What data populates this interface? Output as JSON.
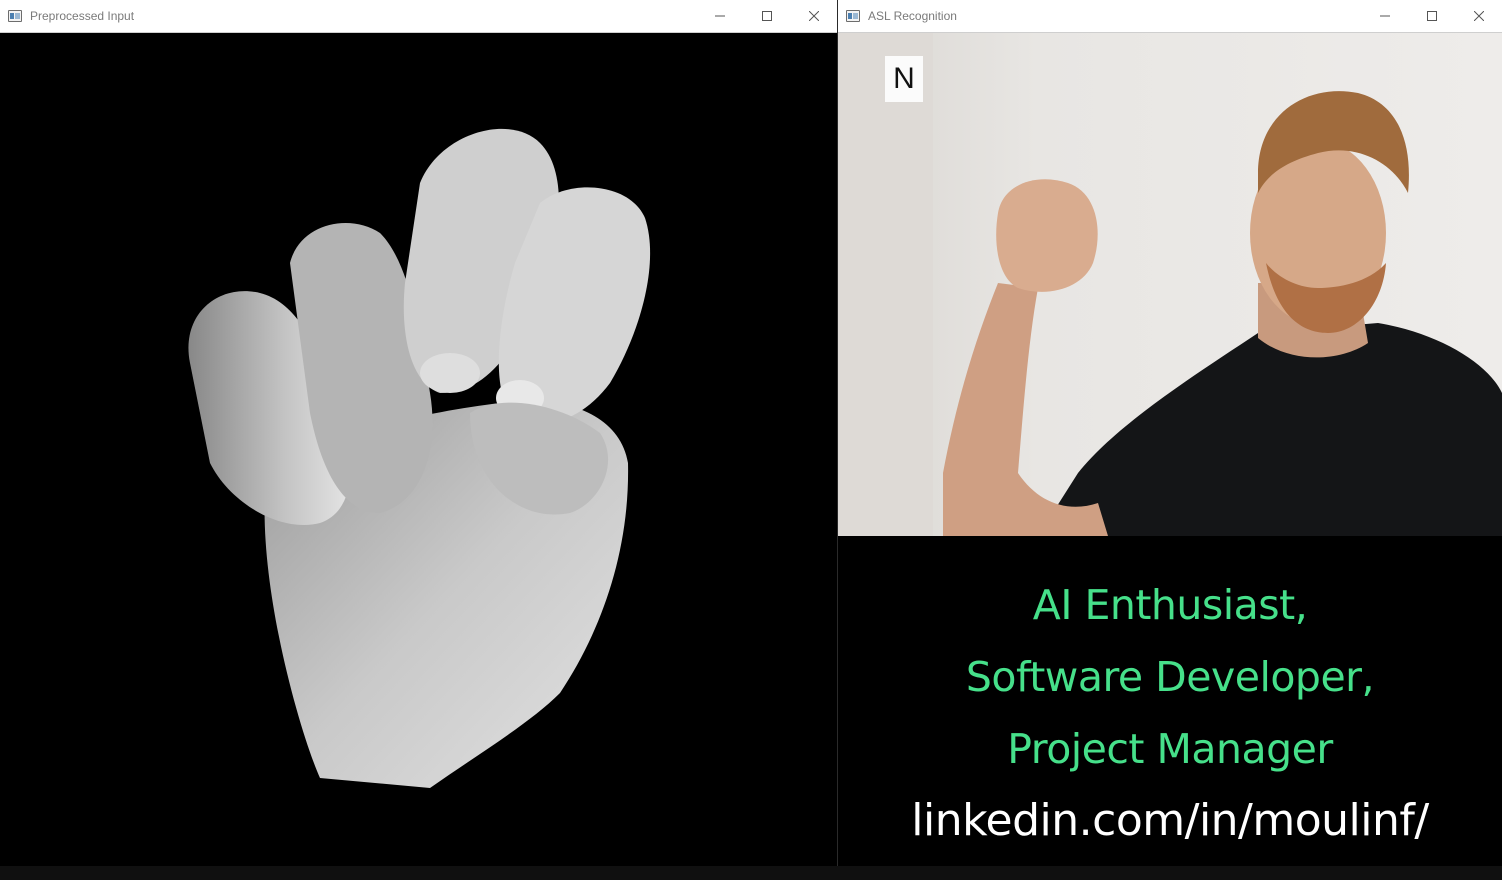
{
  "windows": {
    "left": {
      "title": "Preprocessed Input",
      "icon": "app-window-icon",
      "controls": [
        "minimize",
        "maximize",
        "close"
      ]
    },
    "right": {
      "title": "ASL Recognition",
      "icon": "app-window-icon",
      "controls": [
        "minimize",
        "maximize",
        "close"
      ],
      "prediction": "N"
    }
  },
  "overlay": {
    "lines": [
      "AI Enthusiast,",
      "Software Developer,",
      "Project Manager"
    ],
    "link": "linkedin.com/in/moulinf/"
  },
  "colors": {
    "caption_green": "#46e08a",
    "caption_white": "#ffffff",
    "background": "#000000"
  }
}
